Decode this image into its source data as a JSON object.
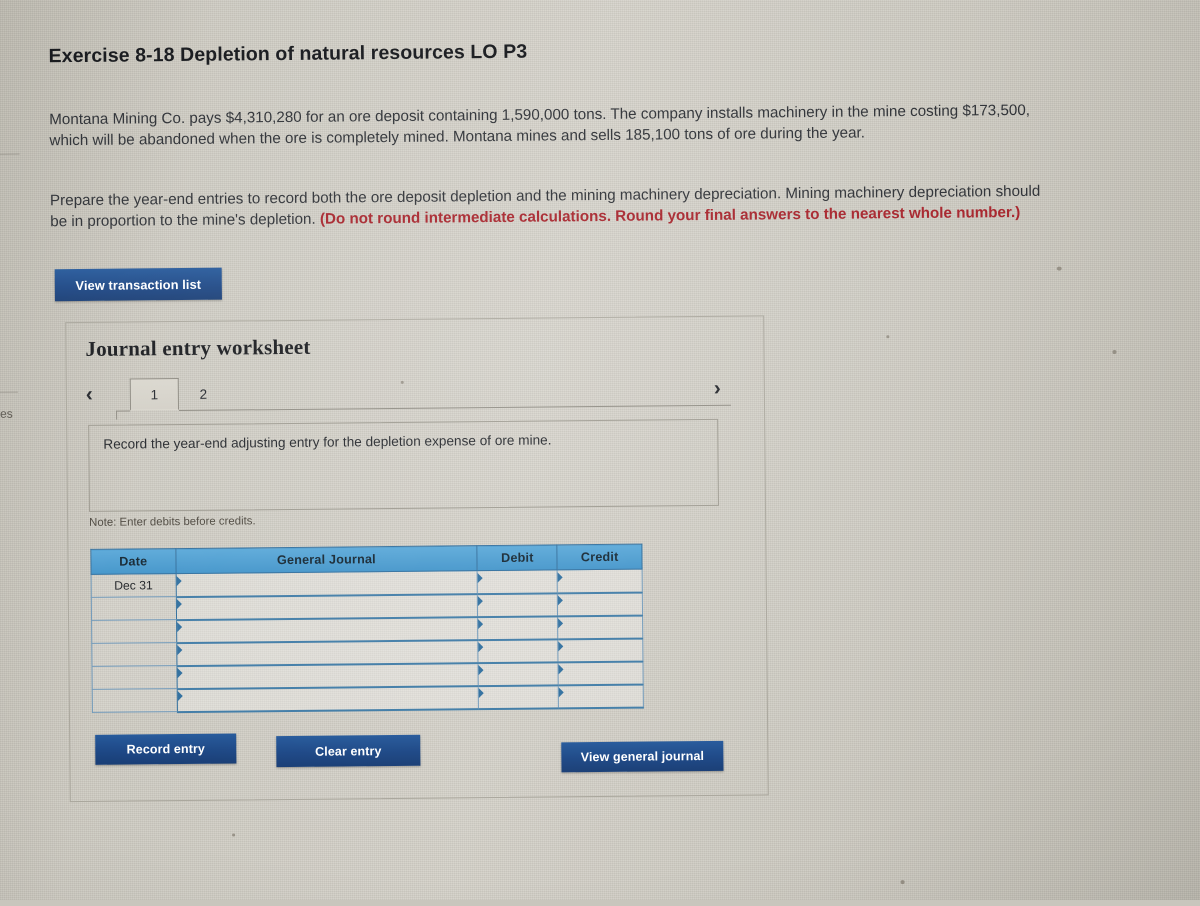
{
  "page": {
    "background_color": "#cecbc2",
    "left_edge_fragment": "es"
  },
  "question": {
    "title": "Exercise 8-18 Depletion of natural resources LO P3",
    "paragraph_1": "Montana Mining Co. pays $4,310,280 for an ore deposit containing 1,590,000 tons. The company installs machinery in the mine costing $173,500, which will be abandoned when the ore is completely mined. Montana mines and sells 185,100 tons of ore during the year.",
    "paragraph_2_plain": "Prepare the year-end entries to record both the ore deposit depletion and the mining machinery depreciation. Mining machinery depreciation should be in proportion to the mine's depletion. ",
    "paragraph_2_emphasis": "(Do not round intermediate calculations. Round your final answers to the nearest whole number.)",
    "emphasis_color": "#a52028",
    "values": {
      "ore_deposit_cost": "$4,310,280",
      "ore_deposit_tons": "1,590,000",
      "machinery_cost": "$173,500",
      "tons_sold": "185,100"
    }
  },
  "toolbar": {
    "view_transaction_list_label": "View transaction list"
  },
  "worksheet": {
    "title": "Journal entry worksheet",
    "prev_arrow": "‹",
    "next_arrow": "›",
    "tabs": [
      {
        "label": "1",
        "active": true
      },
      {
        "label": "2",
        "active": false
      }
    ],
    "prompt": "Record the year-end adjusting entry for the depletion expense of ore mine.",
    "note": "Note: Enter debits before credits.",
    "header_color": "#4a9ed4",
    "button_color": "#1b4685",
    "table": {
      "columns": [
        "Date",
        "General Journal",
        "Debit",
        "Credit"
      ],
      "rows": [
        {
          "date": "Dec 31",
          "general_journal": "",
          "debit": "",
          "credit": ""
        },
        {
          "date": "",
          "general_journal": "",
          "debit": "",
          "credit": ""
        },
        {
          "date": "",
          "general_journal": "",
          "debit": "",
          "credit": ""
        },
        {
          "date": "",
          "general_journal": "",
          "debit": "",
          "credit": ""
        },
        {
          "date": "",
          "general_journal": "",
          "debit": "",
          "credit": ""
        },
        {
          "date": "",
          "general_journal": "",
          "debit": "",
          "credit": ""
        }
      ]
    },
    "actions": {
      "record_entry_label": "Record entry",
      "clear_entry_label": "Clear entry",
      "view_general_journal_label": "View general journal"
    }
  }
}
